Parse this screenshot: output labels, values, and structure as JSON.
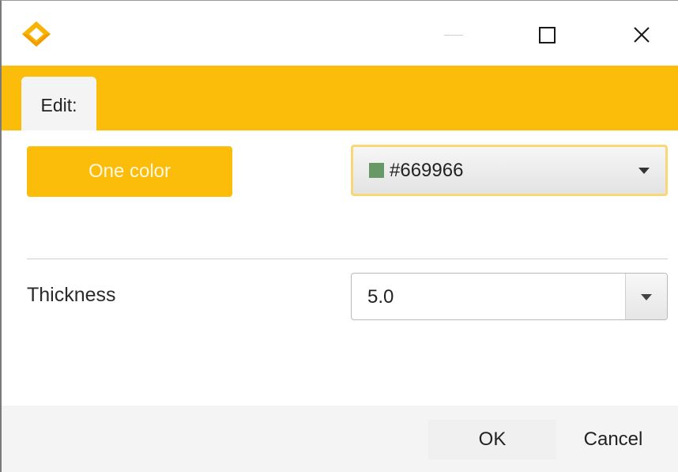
{
  "window": {
    "brand_color": "#fbbd0a",
    "icons": {
      "app": "app-logo-icon",
      "minimize": "minimize-icon",
      "maximize": "maximize-icon",
      "close": "close-icon"
    }
  },
  "tabs": [
    {
      "label": "Edit:",
      "active": true
    }
  ],
  "editor": {
    "one_color_label": "One color",
    "color_picker": {
      "value": "#669966",
      "swatch_color": "#669966",
      "icon": "chevron-down-icon"
    },
    "thickness": {
      "label": "Thickness",
      "value": "5.0",
      "icon": "chevron-down-icon"
    }
  },
  "footer": {
    "ok_label": "OK",
    "cancel_label": "Cancel"
  }
}
